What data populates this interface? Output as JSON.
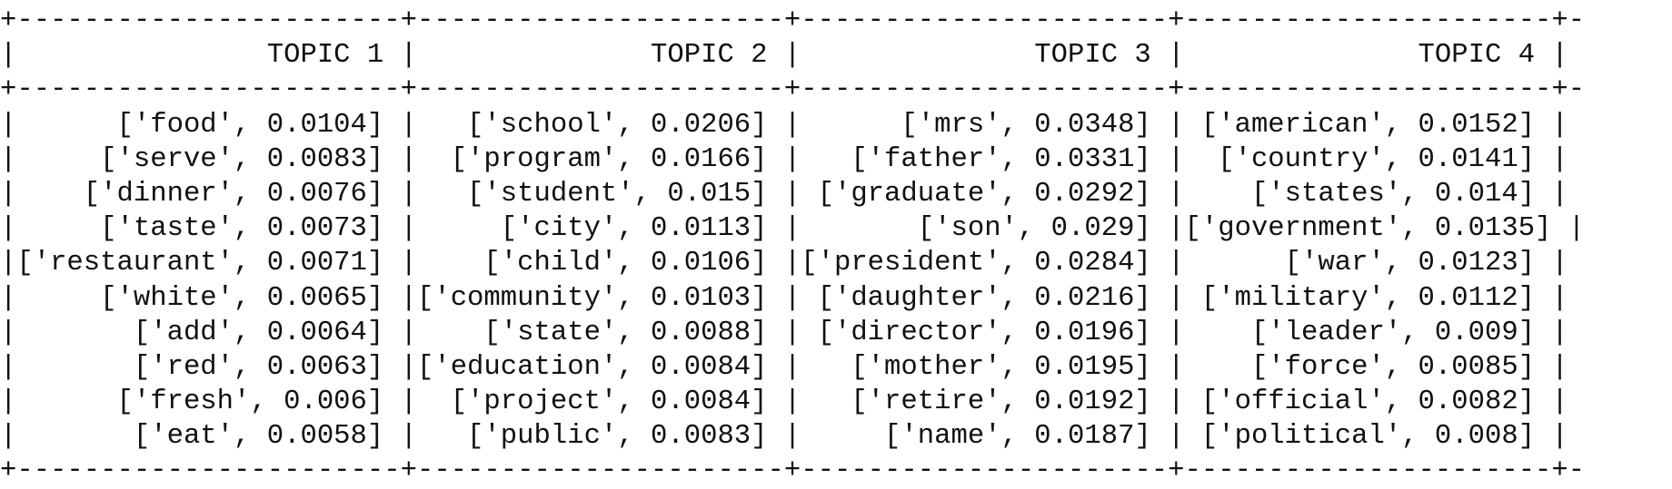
{
  "table": {
    "headers": [
      "TOPIC 1",
      "TOPIC 2",
      "TOPIC 3",
      "TOPIC 4"
    ],
    "rows": [
      [
        "['food', 0.0104]",
        "['school', 0.0206]",
        "['mrs', 0.0348]",
        "['american', 0.0152]"
      ],
      [
        "['serve', 0.0083]",
        "['program', 0.0166]",
        "['father', 0.0331]",
        "['country', 0.0141]"
      ],
      [
        "['dinner', 0.0076]",
        "['student', 0.015]",
        "['graduate', 0.0292]",
        "['states', 0.014]"
      ],
      [
        "['taste', 0.0073]",
        "['city', 0.0113]",
        "['son', 0.029]",
        "['government', 0.0135]"
      ],
      [
        "['restaurant', 0.0071]",
        "['child', 0.0106]",
        "['president', 0.0284]",
        "['war', 0.0123]"
      ],
      [
        "['white', 0.0065]",
        "['community', 0.0103]",
        "['daughter', 0.0216]",
        "['military', 0.0112]"
      ],
      [
        "['add', 0.0064]",
        "['state', 0.0088]",
        "['director', 0.0196]",
        "['leader', 0.009]"
      ],
      [
        "['red', 0.0063]",
        "['education', 0.0084]",
        "['mother', 0.0195]",
        "['force', 0.0085]"
      ],
      [
        "['fresh', 0.006]",
        "['project', 0.0084]",
        "['retire', 0.0192]",
        "['official', 0.0082]"
      ],
      [
        "['eat', 0.0058]",
        "['public', 0.0083]",
        "['name', 0.0187]",
        "['political', 0.008]"
      ]
    ]
  }
}
